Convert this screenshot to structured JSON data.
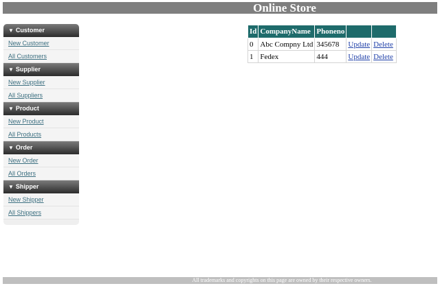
{
  "header": {
    "title": "Online Store"
  },
  "sidebar": {
    "sections": [
      {
        "label": "Customer",
        "links": [
          "New Customer",
          "All Customers"
        ]
      },
      {
        "label": "Supplier",
        "links": [
          "New Supplier",
          "All Suppliers"
        ]
      },
      {
        "label": "Product",
        "links": [
          "New Product",
          "All Products"
        ]
      },
      {
        "label": "Order",
        "links": [
          "New Order",
          "All Orders"
        ]
      },
      {
        "label": "Shipper",
        "links": [
          "New Shipper",
          "All Shippers"
        ]
      }
    ]
  },
  "table": {
    "columns": [
      "Id",
      "CompanyName",
      "Phoneno",
      "",
      ""
    ],
    "rows": [
      {
        "id": "0",
        "company": "Abc Compny Ltd",
        "phone": "345678",
        "update": "Update",
        "delete": "Delete"
      },
      {
        "id": "1",
        "company": "Fedex",
        "phone": "444",
        "update": "Update",
        "delete": "Delete"
      }
    ]
  },
  "footer": {
    "text": "All trademarks and copyrights on this page are owned by their respective owners."
  }
}
